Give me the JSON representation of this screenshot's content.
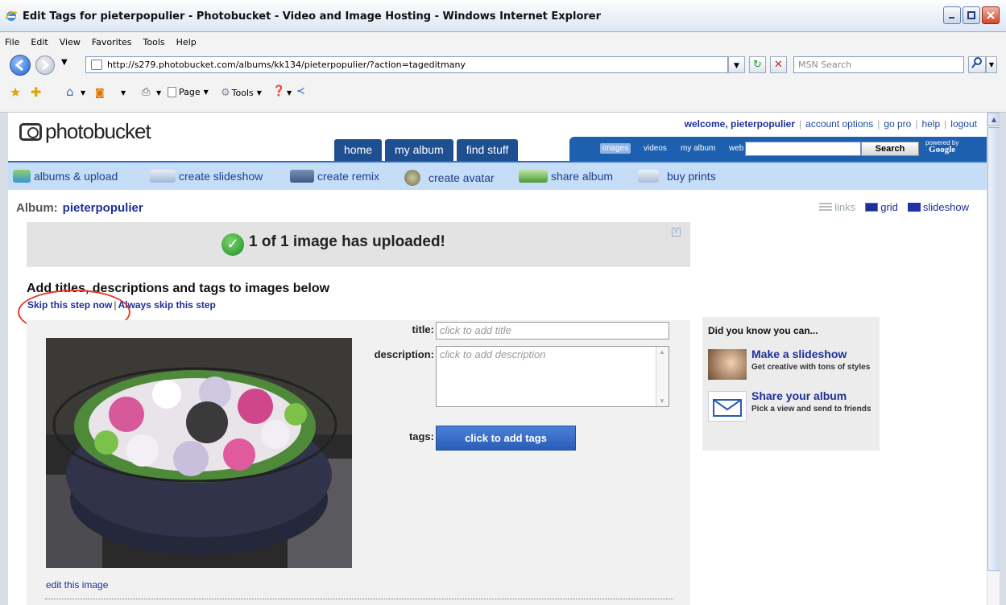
{
  "window": {
    "title": "Edit Tags for pieterpopulier - Photobucket - Video and Image Hosting - Windows Internet Explorer"
  },
  "menu": [
    "File",
    "Edit",
    "View",
    "Favorites",
    "Tools",
    "Help"
  ],
  "address": {
    "url": "http://s279.photobucket.com/albums/kk134/pieterpopulier/?action=tageditmany",
    "search_placeholder": "MSN Search"
  },
  "favbar": {
    "page_label": "Page",
    "tools_label": "Tools"
  },
  "site": {
    "logo_text": "photobucket",
    "toplinks": {
      "welcome": "welcome, pieterpopulier",
      "account": "account options",
      "gopro": "go pro",
      "help": "help",
      "logout": "logout"
    },
    "tabs": [
      "home",
      "my album",
      "find stuff"
    ],
    "search_opts": [
      "images",
      "videos",
      "my album",
      "web"
    ],
    "search_button": "Search",
    "powered_by": "powered by",
    "powered_brand": "Google",
    "subnav": [
      "albums & upload",
      "create slideshow",
      "create remix",
      "create avatar",
      "share album",
      "buy prints"
    ]
  },
  "album": {
    "label": "Album:",
    "name": "pieterpopulier",
    "views": [
      "links",
      "grid",
      "slideshow"
    ]
  },
  "banner": {
    "message": "1 of 1 image has uploaded!"
  },
  "editor": {
    "heading": "Add titles, descriptions and tags to images below",
    "skip_now": "Skip this step now",
    "skip_always": "Always skip this step",
    "separator": "|",
    "title_label": "title:",
    "title_placeholder": "click to add title",
    "description_label": "description:",
    "description_placeholder": "click to add description",
    "tags_label": "tags:",
    "tags_button": "click to add tags",
    "edit_image": "edit this image"
  },
  "didyouknow": {
    "heading": "Did you know you can...",
    "items": [
      {
        "title": "Make a slideshow",
        "desc": "Get creative with tons of styles"
      },
      {
        "title": "Share your album",
        "desc": "Pick a view and send to friends"
      }
    ]
  }
}
